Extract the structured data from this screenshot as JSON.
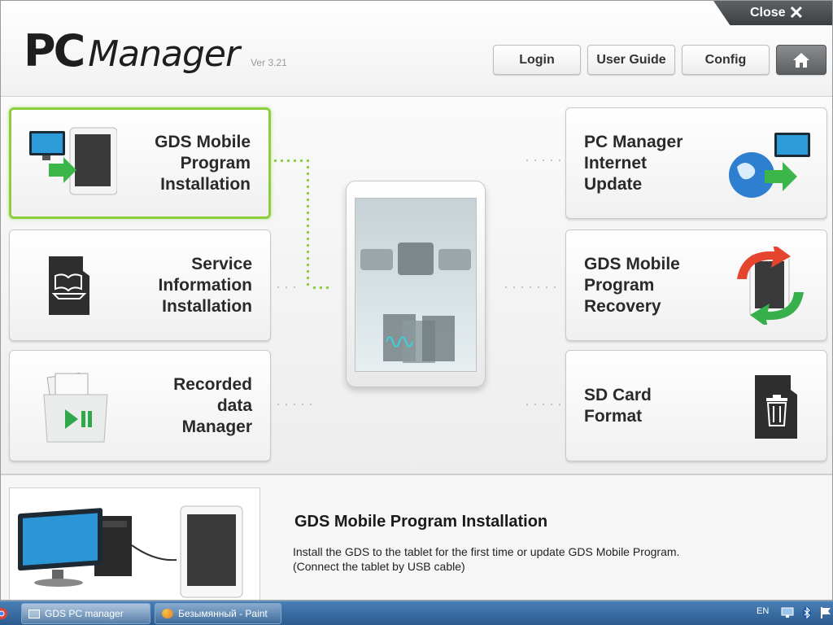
{
  "header": {
    "logo_pc": "PC",
    "logo_manager": "Manager",
    "version": "Ver 3.21",
    "close_label": "Close",
    "buttons": {
      "login": "Login",
      "user_guide": "User Guide",
      "config": "Config"
    }
  },
  "tiles": {
    "gds_install": "GDS Mobile\nProgram\nInstallation",
    "service_info": "Service\nInformation\nInstallation",
    "recorded_data": "Recorded\ndata\nManager",
    "internet_update": "PC Manager\nInternet\nUpdate",
    "program_recovery": "GDS Mobile\nProgram\nRecovery",
    "sd_format": "SD Card\nFormat"
  },
  "description": {
    "title": "GDS Mobile Program Installation",
    "line1": "Install the GDS to the tablet for the first time or update GDS Mobile Program.",
    "line2": "(Connect the tablet by USB cable)"
  },
  "taskbar": {
    "tasks": [
      {
        "label": "GDS PC manager"
      },
      {
        "label": "Безымянный - Paint"
      }
    ],
    "language": "EN"
  },
  "colors": {
    "active_border": "#8cce3c",
    "accent_green": "#2ea84a",
    "taskbar": "#2b5b8f"
  }
}
